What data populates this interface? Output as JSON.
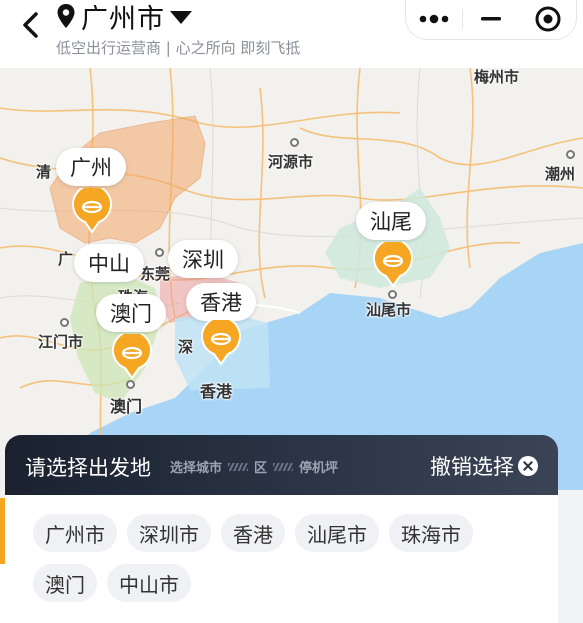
{
  "header": {
    "city": "广州市",
    "subtitle": "低空出行运营商 | 心之所向 即刻飞抵"
  },
  "map": {
    "labels": {
      "meizhou": "梅州市",
      "heyuan": "河源市",
      "chaozhou": "潮州",
      "qing": "清",
      "guang": "广",
      "dong": "东莞",
      "zhuhai_part": "珠海",
      "jiangmen": "江门市",
      "shen": "深",
      "shanwei": "汕尾市",
      "hongkong": "香港",
      "macau": "澳门"
    },
    "bubbles": {
      "guangzhou": "广州",
      "zhongshan": "中山",
      "shenzhen": "深圳",
      "hongkong": "香港",
      "macau": "澳门",
      "shanwei": "汕尾"
    }
  },
  "sheet": {
    "title": "请选择出发地",
    "steps": [
      "选择城市",
      "区",
      "停机坪"
    ],
    "cancel": "撤销选择",
    "cities": [
      "广州市",
      "深圳市",
      "香港",
      "汕尾市",
      "珠海市",
      "澳门",
      "中山市"
    ]
  },
  "colors": {
    "accent": "#f5a623",
    "sea": "#a8d4f5",
    "sheet_dark": "#1a2230"
  }
}
